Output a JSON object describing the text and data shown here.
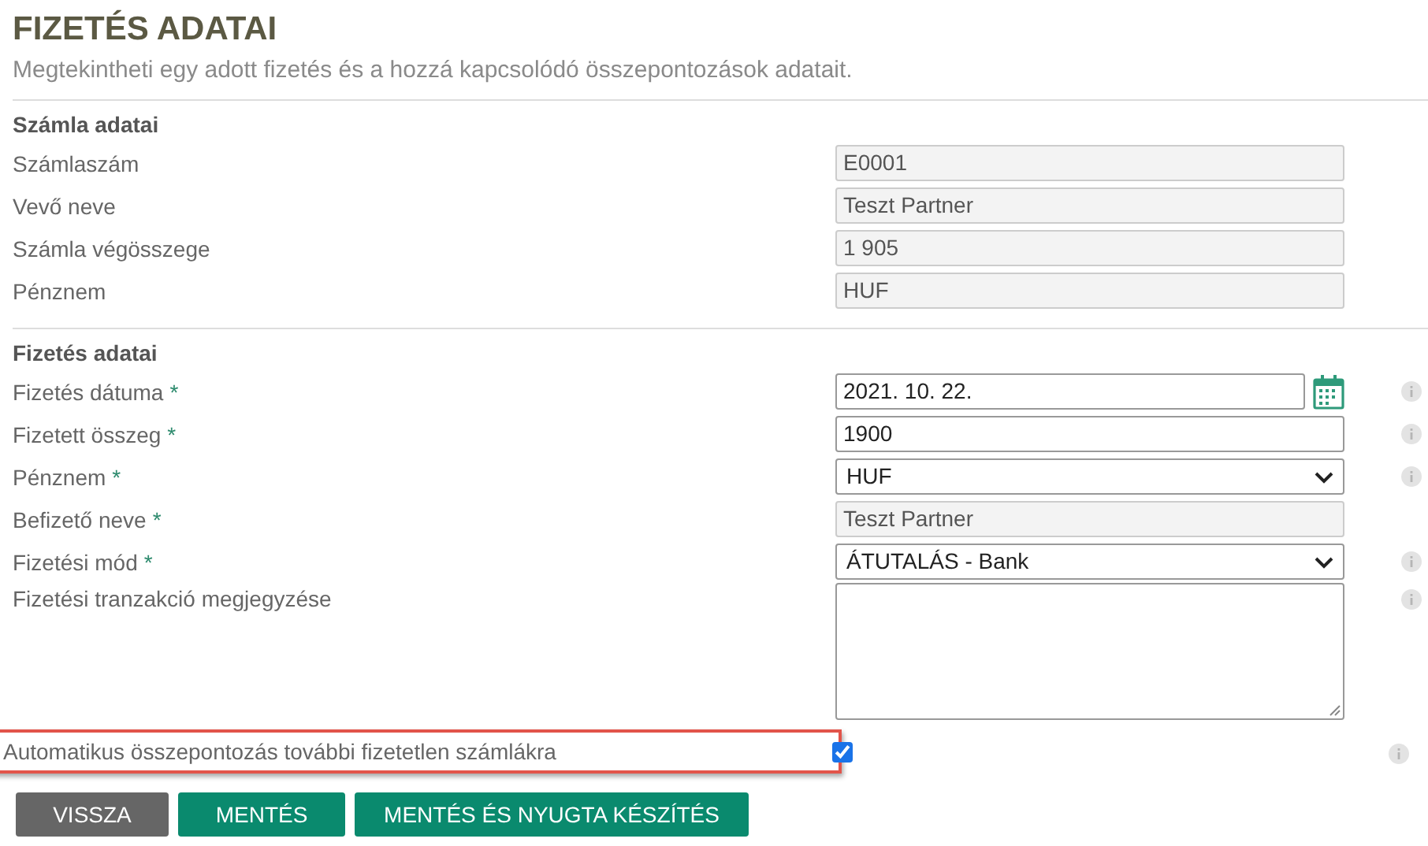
{
  "title": "FIZETÉS ADATAI",
  "subtitle": "Megtekintheti egy adott fizetés és a hozzá kapcsolódó összepontozások adatait.",
  "sections": [
    {
      "heading": "Számla adatai",
      "fields": [
        {
          "label": "Számlaszám",
          "kind": "readonly",
          "value": "E0001",
          "info": false
        },
        {
          "label": "Vevő neve",
          "kind": "readonly",
          "value": "Teszt Partner",
          "info": false
        },
        {
          "label": "Számla végösszege",
          "kind": "readonly",
          "value": "1 905",
          "info": false
        },
        {
          "label": "Pénznem",
          "kind": "readonly",
          "value": "HUF",
          "info": false
        }
      ]
    },
    {
      "heading": "Fizetés adatai",
      "fields": [
        {
          "label": "Fizetés dátuma",
          "required_mark": "*",
          "kind": "date",
          "value": "2021. 10. 22.",
          "info": true
        },
        {
          "label": "Fizetett összeg",
          "required_mark": "*",
          "kind": "text",
          "value": "1900",
          "info": true
        },
        {
          "label": "Pénznem",
          "required_mark": "*",
          "kind": "select",
          "value": "HUF",
          "info": true
        },
        {
          "label": "Befizető neve",
          "required_mark": "*",
          "kind": "readonly",
          "value": "Teszt Partner",
          "info": false
        },
        {
          "label": "Fizetési mód",
          "required_mark": "*",
          "kind": "select",
          "value": "ÁTUTALÁS - Bank",
          "info": true
        },
        {
          "label": "Fizetési tranzakció megjegyzése",
          "kind": "textarea",
          "info": true
        },
        {
          "label": "Automatikus összepontozás további fizetetlen számlákra",
          "kind": "checkbox",
          "checked": true,
          "highlighted": true,
          "info": true
        }
      ]
    }
  ],
  "buttons": [
    {
      "label": "VISSZA",
      "kind": "secondary"
    },
    {
      "label": "MENTÉS",
      "kind": "primary"
    },
    {
      "label": "MENTÉS ÉS NYUGTA KÉSZÍTÉS",
      "kind": "primary"
    }
  ]
}
